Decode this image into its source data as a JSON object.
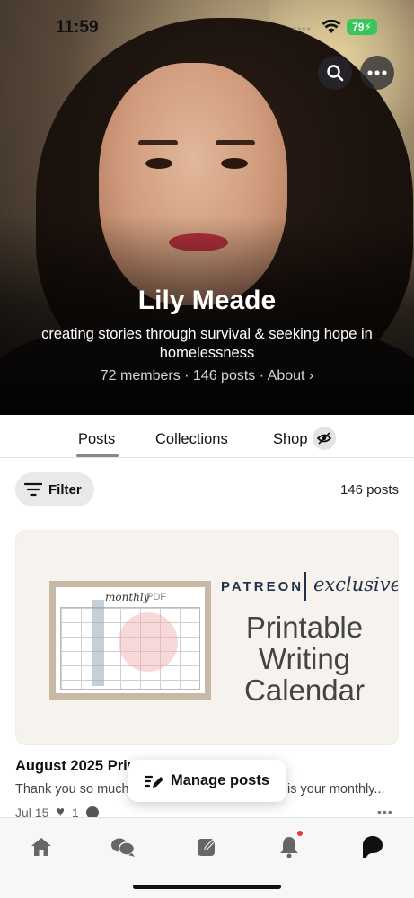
{
  "status_bar": {
    "time": "11:59",
    "battery": "79"
  },
  "header": {
    "search_icon": "search-icon",
    "more_icon": "more-icon"
  },
  "creator": {
    "name": "Lily Meade",
    "tagline": "creating stories through survival & seeking hope in homelessness",
    "members": "72 members",
    "posts": "146 posts",
    "about": "About"
  },
  "tabs": [
    {
      "label": "Posts",
      "active": true
    },
    {
      "label": "Collections",
      "active": false
    },
    {
      "label": "Shop",
      "active": false
    }
  ],
  "filter": {
    "label": "Filter",
    "post_count": "146 posts"
  },
  "post": {
    "image": {
      "brand": "PATREON",
      "exclusive": "exclusive",
      "title": "Printable Writing Calendar",
      "calendar_label": "monthly",
      "calendar_sub": "PDF"
    },
    "title": "August 2025 Printable Writing Calendar",
    "excerpt_start": "Thank you so much",
    "excerpt_end": "is your monthly...",
    "date": "Jul 15",
    "likes": "1"
  },
  "manage_posts": {
    "label": "Manage posts"
  },
  "bottom_nav": [
    {
      "icon": "home-icon"
    },
    {
      "icon": "chat-icon"
    },
    {
      "icon": "create-icon"
    },
    {
      "icon": "bell-icon"
    },
    {
      "icon": "patreon-icon"
    }
  ],
  "colors": {
    "accent_navy": "#203046",
    "battery_green": "#35c759",
    "notification_red": "#e23b3b"
  }
}
